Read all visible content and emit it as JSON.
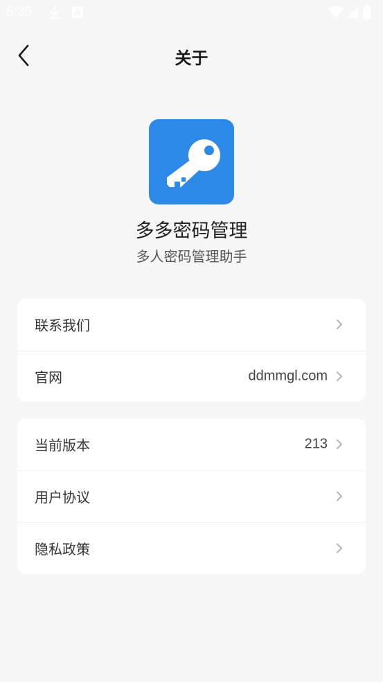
{
  "status_bar": {
    "time": "5:35",
    "icons": [
      "download-icon",
      "a-badge-icon",
      "wifi-icon",
      "signal-icon",
      "battery-icon"
    ]
  },
  "nav": {
    "title": "关于",
    "back_icon": "chevron-left-icon"
  },
  "app": {
    "icon": "key-icon",
    "icon_color": "#2c89e8",
    "name": "多多密码管理",
    "slogan": "多人密码管理助手"
  },
  "group1": {
    "items": [
      {
        "label": "联系我们",
        "value": ""
      },
      {
        "label": "官网",
        "value": "ddmmgl.com"
      }
    ]
  },
  "group2": {
    "items": [
      {
        "label": "当前版本",
        "value": "213"
      },
      {
        "label": "用户协议",
        "value": ""
      },
      {
        "label": "隐私政策",
        "value": ""
      }
    ]
  }
}
